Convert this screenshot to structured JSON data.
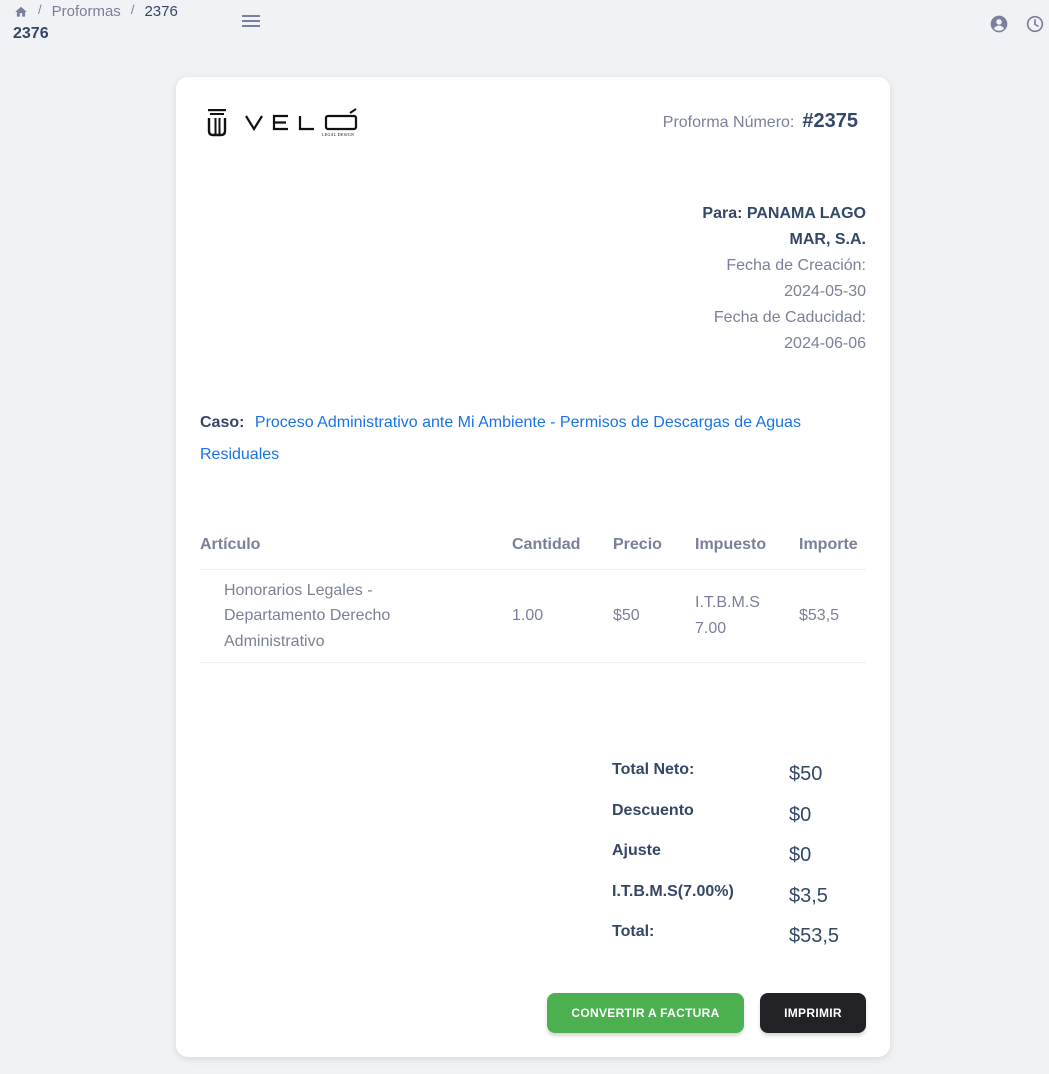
{
  "breadcrumb": {
    "home_icon": "home-icon",
    "items": [
      "Proformas",
      "2376"
    ],
    "separator": "/"
  },
  "page_title": "2376",
  "top_icons": [
    "menu-icon",
    "user-circle-icon",
    "clock-icon"
  ],
  "logo": {
    "text": "VELO",
    "subtext": "LEGAL DESIGN"
  },
  "proforma": {
    "label": "Proforma Número:",
    "number": "#2375"
  },
  "client": {
    "to": "Para: PANAMA LAGO MAR, S.A.",
    "created_label": "Fecha de Creación:",
    "created_value": "2024-05-30",
    "expires_label": "Fecha de Caducidad:",
    "expires_value": "2024-06-06"
  },
  "case": {
    "label": "Caso:",
    "value": "Proceso Administrativo ante Mi Ambiente - Permisos de Descargas de Aguas Residuales"
  },
  "table": {
    "headers": [
      "Artículo",
      "Cantidad",
      "Precio",
      "Impuesto",
      "Importe"
    ],
    "rows": [
      {
        "article": "Honorarios Legales - Departamento Derecho Administrativo",
        "quantity": "1.00",
        "price": "$50",
        "tax": "I.T.B.M.S 7.00",
        "amount": "$53,5"
      }
    ]
  },
  "totals": [
    {
      "label": "Total Neto:",
      "value": "$50"
    },
    {
      "label": "Descuento",
      "value": "$0"
    },
    {
      "label": "Ajuste",
      "value": "$0"
    },
    {
      "label": "I.T.B.M.S(7.00%)",
      "value": "$3,5"
    },
    {
      "label": "Total:",
      "value": "$53,5"
    }
  ],
  "buttons": {
    "convert": "CONVERTIR A FACTURA",
    "print": "IMPRIMIR"
  },
  "colors": {
    "accent_link": "#1A73E8",
    "convert": "#4CAF50",
    "print": "#222226"
  }
}
